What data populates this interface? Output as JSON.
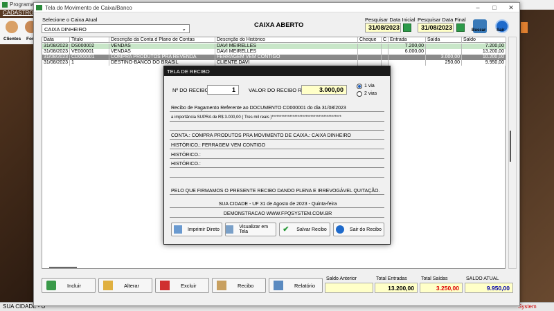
{
  "background": {
    "title": "Programa C",
    "menu": "CADASTROS",
    "toolbar": [
      "Clientes",
      "Forn"
    ],
    "status_left": "SUA CIDADE - U",
    "status_right": "System"
  },
  "window": {
    "title": "Tela do Movimento de Caixa/Banco",
    "select_label": "Selecione o Caixa Atual",
    "select_value": "CAIXA DINHEIRO",
    "status_title": "CAIXA ABERTO",
    "date_start_label": "Pesquisar Data Inicial",
    "date_start": "31/08/2023",
    "date_end_label": "Pesquisar Data Final",
    "date_end": "31/08/2023",
    "search_label": "Buscar",
    "exit_label": "Sair"
  },
  "grid": {
    "headers": [
      "Data",
      "Titulo",
      "Descrição da Conta d Plano de Contas",
      "Descrição do Histórico",
      "Cheque",
      "C",
      "Entrada",
      "Saída",
      "Saldo"
    ],
    "rows": [
      [
        "31/08/2023",
        "DS000002",
        "VENDAS",
        "DAVI MEIRELLES",
        "",
        "",
        "7.200,00",
        "",
        "7.200,00"
      ],
      [
        "31/08/2023",
        "VE000001",
        "VENDAS",
        "DAVI MEIRELLES",
        "",
        "",
        "6.000,00",
        "",
        "13.200,00"
      ],
      [
        "31/08/2023",
        "CD000001",
        "COMPRA PRODUTOS PRA REVENDA",
        "FERRAGEM VEM CONTIGO",
        "",
        "",
        "",
        "3.000,00",
        "10.200,00"
      ],
      [
        "31/08/2023",
        "1",
        "DESTINO-BANCO DO BRASIL",
        "CLIENTE DAVI",
        "",
        "",
        "",
        "250,00",
        "9.950,00"
      ]
    ]
  },
  "buttons": {
    "incluir": "Incluir",
    "alterar": "Alterar",
    "excluir": "Excluir",
    "recibo": "Recibo",
    "relatorio": "Relatório"
  },
  "summary": {
    "saldo_anterior_label": "Saldo Anterior",
    "saldo_anterior": "",
    "total_entradas_label": "Total Entradas",
    "total_entradas": "13.200,00",
    "total_saidas_label": "Total Saídas",
    "total_saidas": "3.250,00",
    "saldo_atual_label": "SALDO ATUAL",
    "saldo_atual": "9.950,00"
  },
  "dialog": {
    "title": "TELA DE RECIBO",
    "num_label": "Nº DO RECIBO",
    "num_value": "1",
    "valor_label": "VALOR DO RECIBO R$",
    "valor_value": "3.000,00",
    "via1": "1 via",
    "via2": "2 vias",
    "lines": [
      "Recibo de Pagamento Referente ao DOCUMENTO CD000001    do dia 31/08/2023",
      "a importância SUPRA de R$    3.000,00 ( Tres mil reais )*******************************************",
      "",
      "CONTA.: COMPRA PRODUTOS PRA  MOVIMENTO DE CAIXA.: CAIXA DINHEIRO",
      "HISTÓRICO.: FERRAGEM VEM CONTIGO",
      "HISTÓRICO.:",
      "HISTÓRICO.:",
      "",
      "PELO QUE FIRMAMOS O PRESENTE RECIBO DANDO PLENA E IRREVOGÁVEL QUITAÇÃO.",
      "SUA CIDADE - UF 31 de Agosto de 2023 - Quinta-feira",
      "DEMONSTRACAO WWW.FPQSYSTEM.COM.BR"
    ],
    "btn_imprimir": "Imprimir Direto",
    "btn_visualizar": "Visualizar em Tela",
    "btn_salvar": "Salvar Recibo",
    "btn_sair": "Sair do Recibo"
  }
}
